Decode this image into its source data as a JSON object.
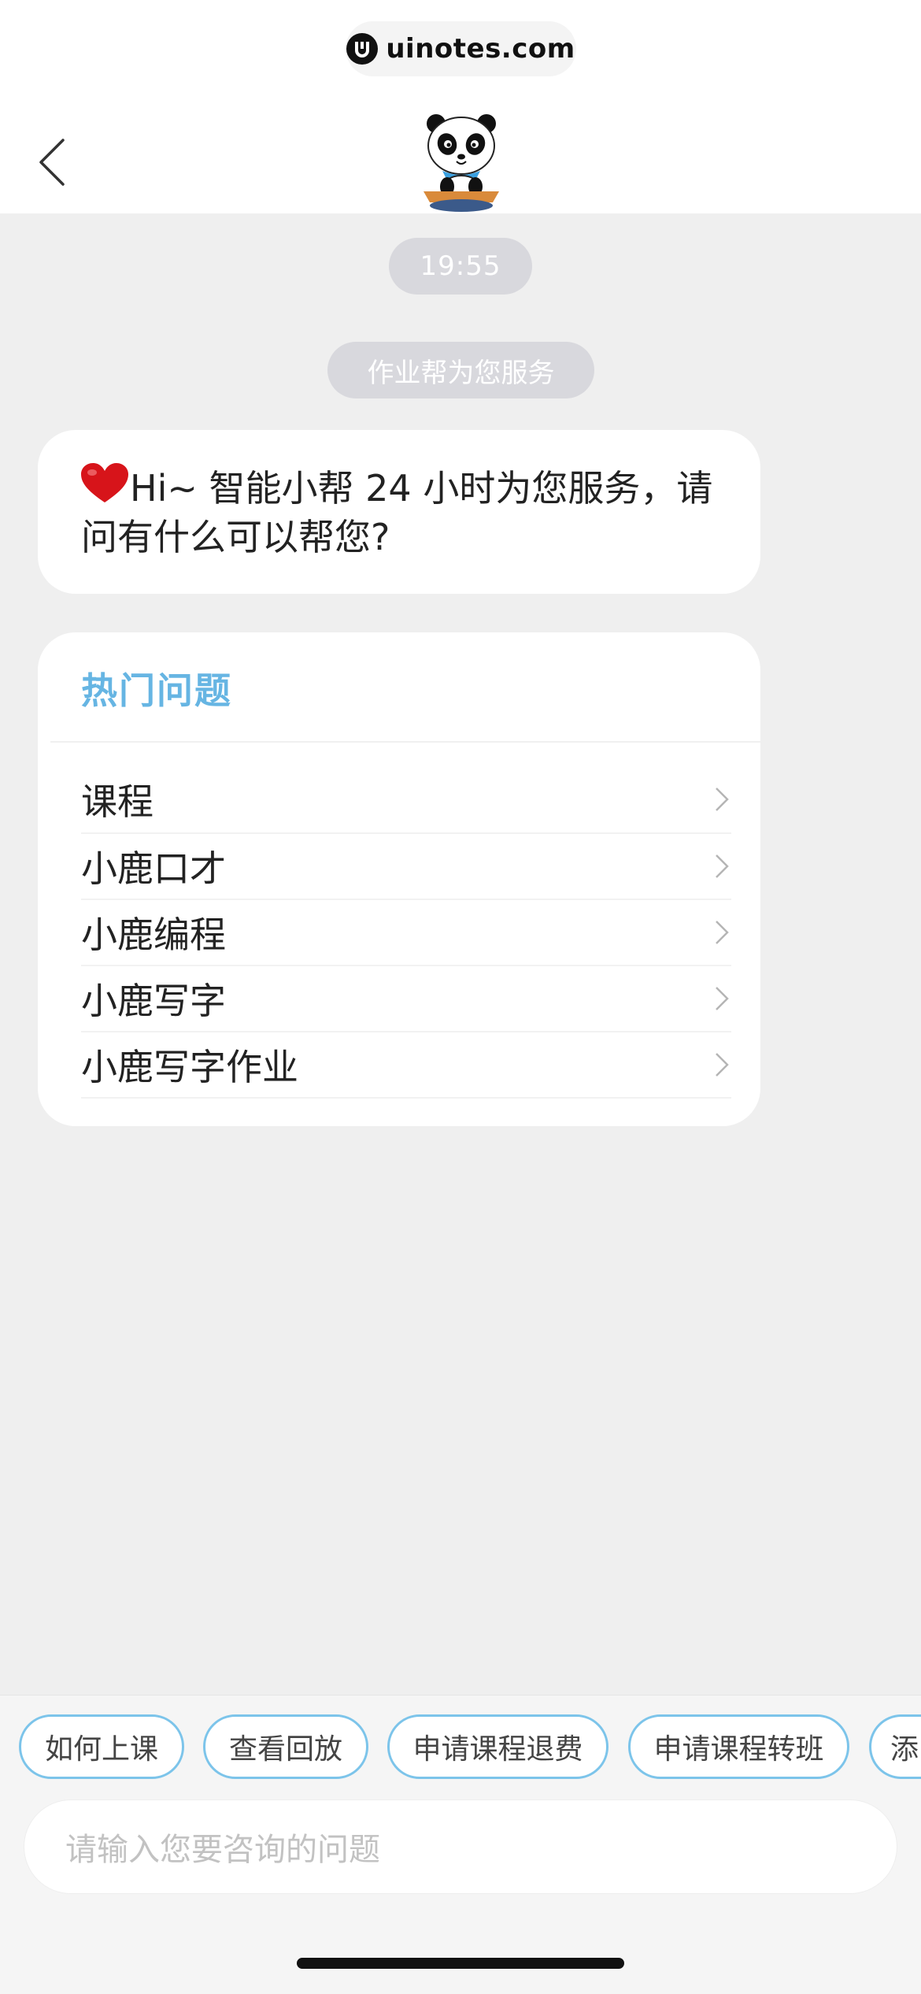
{
  "watermark": {
    "text": "uinotes.com"
  },
  "header": {
    "back_icon": "chevron-left-icon",
    "avatar": "panda-mascot-avatar"
  },
  "chat": {
    "time": "19:55",
    "service_notice": "作业帮为您服务",
    "greeting": {
      "emoji": "heart-emoji",
      "text": "Hi~ 智能小帮 24 小时为您服务，请问有什么可以帮您?"
    },
    "faq": {
      "title": "热门问题",
      "items": [
        {
          "label": "课程"
        },
        {
          "label": "小鹿口才"
        },
        {
          "label": "小鹿编程"
        },
        {
          "label": "小鹿写字"
        },
        {
          "label": "小鹿写字作业"
        }
      ]
    }
  },
  "quick_replies": [
    "如何上课",
    "查看回放",
    "申请课程退费",
    "申请课程转班",
    "添"
  ],
  "input": {
    "placeholder": "请输入您要咨询的问题"
  },
  "colors": {
    "accent": "#66b5e3",
    "chip_border": "#7cc4ea",
    "pill_bg": "#d8d8dd"
  }
}
